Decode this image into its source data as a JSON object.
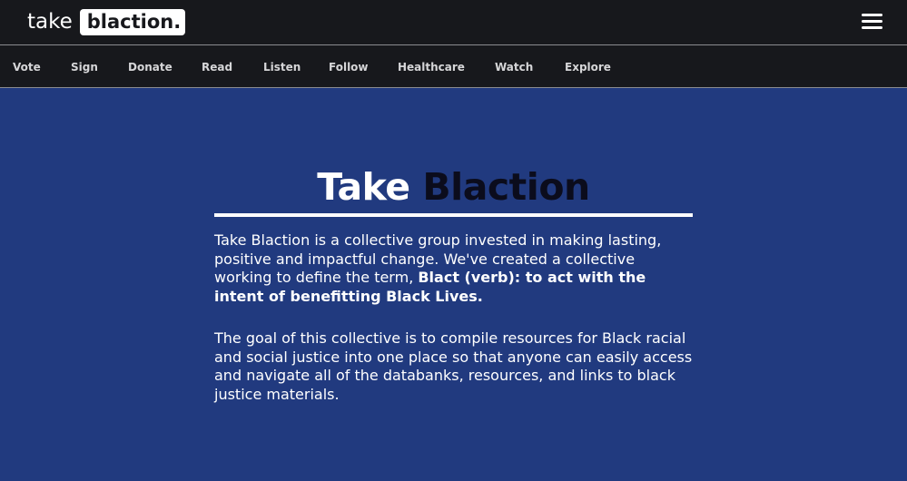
{
  "header": {
    "logo_word": "take",
    "logo_box": "blaction.",
    "menu_icon": "hamburger-menu-icon"
  },
  "nav": {
    "items": [
      {
        "label": "Vote"
      },
      {
        "label": "Sign"
      },
      {
        "label": "Donate"
      },
      {
        "label": "Read"
      },
      {
        "label": "Listen"
      },
      {
        "label": "Follow"
      },
      {
        "label": "Healthcare"
      },
      {
        "label": "Watch"
      },
      {
        "label": "Explore"
      }
    ]
  },
  "main": {
    "title_part1": "Take",
    "title_part2": "Blaction",
    "paragraph1_lead": "Take Blaction is a collective group invested in making lasting, positive and impactful change. We've created a collective working to define the term, ",
    "paragraph1_bold": "Blact (verb): to act with the intent of benefitting Black Lives.",
    "paragraph2": "The goal of this collective is to compile resources for Black racial and social justice into one place so that anyone can easily access and navigate all of the databanks, resources, and links to black justice materials."
  },
  "colors": {
    "header_bg": "#17181c",
    "page_bg": "#213a7f",
    "title_dark": "#0b0c1c",
    "text": "#ffffff"
  }
}
